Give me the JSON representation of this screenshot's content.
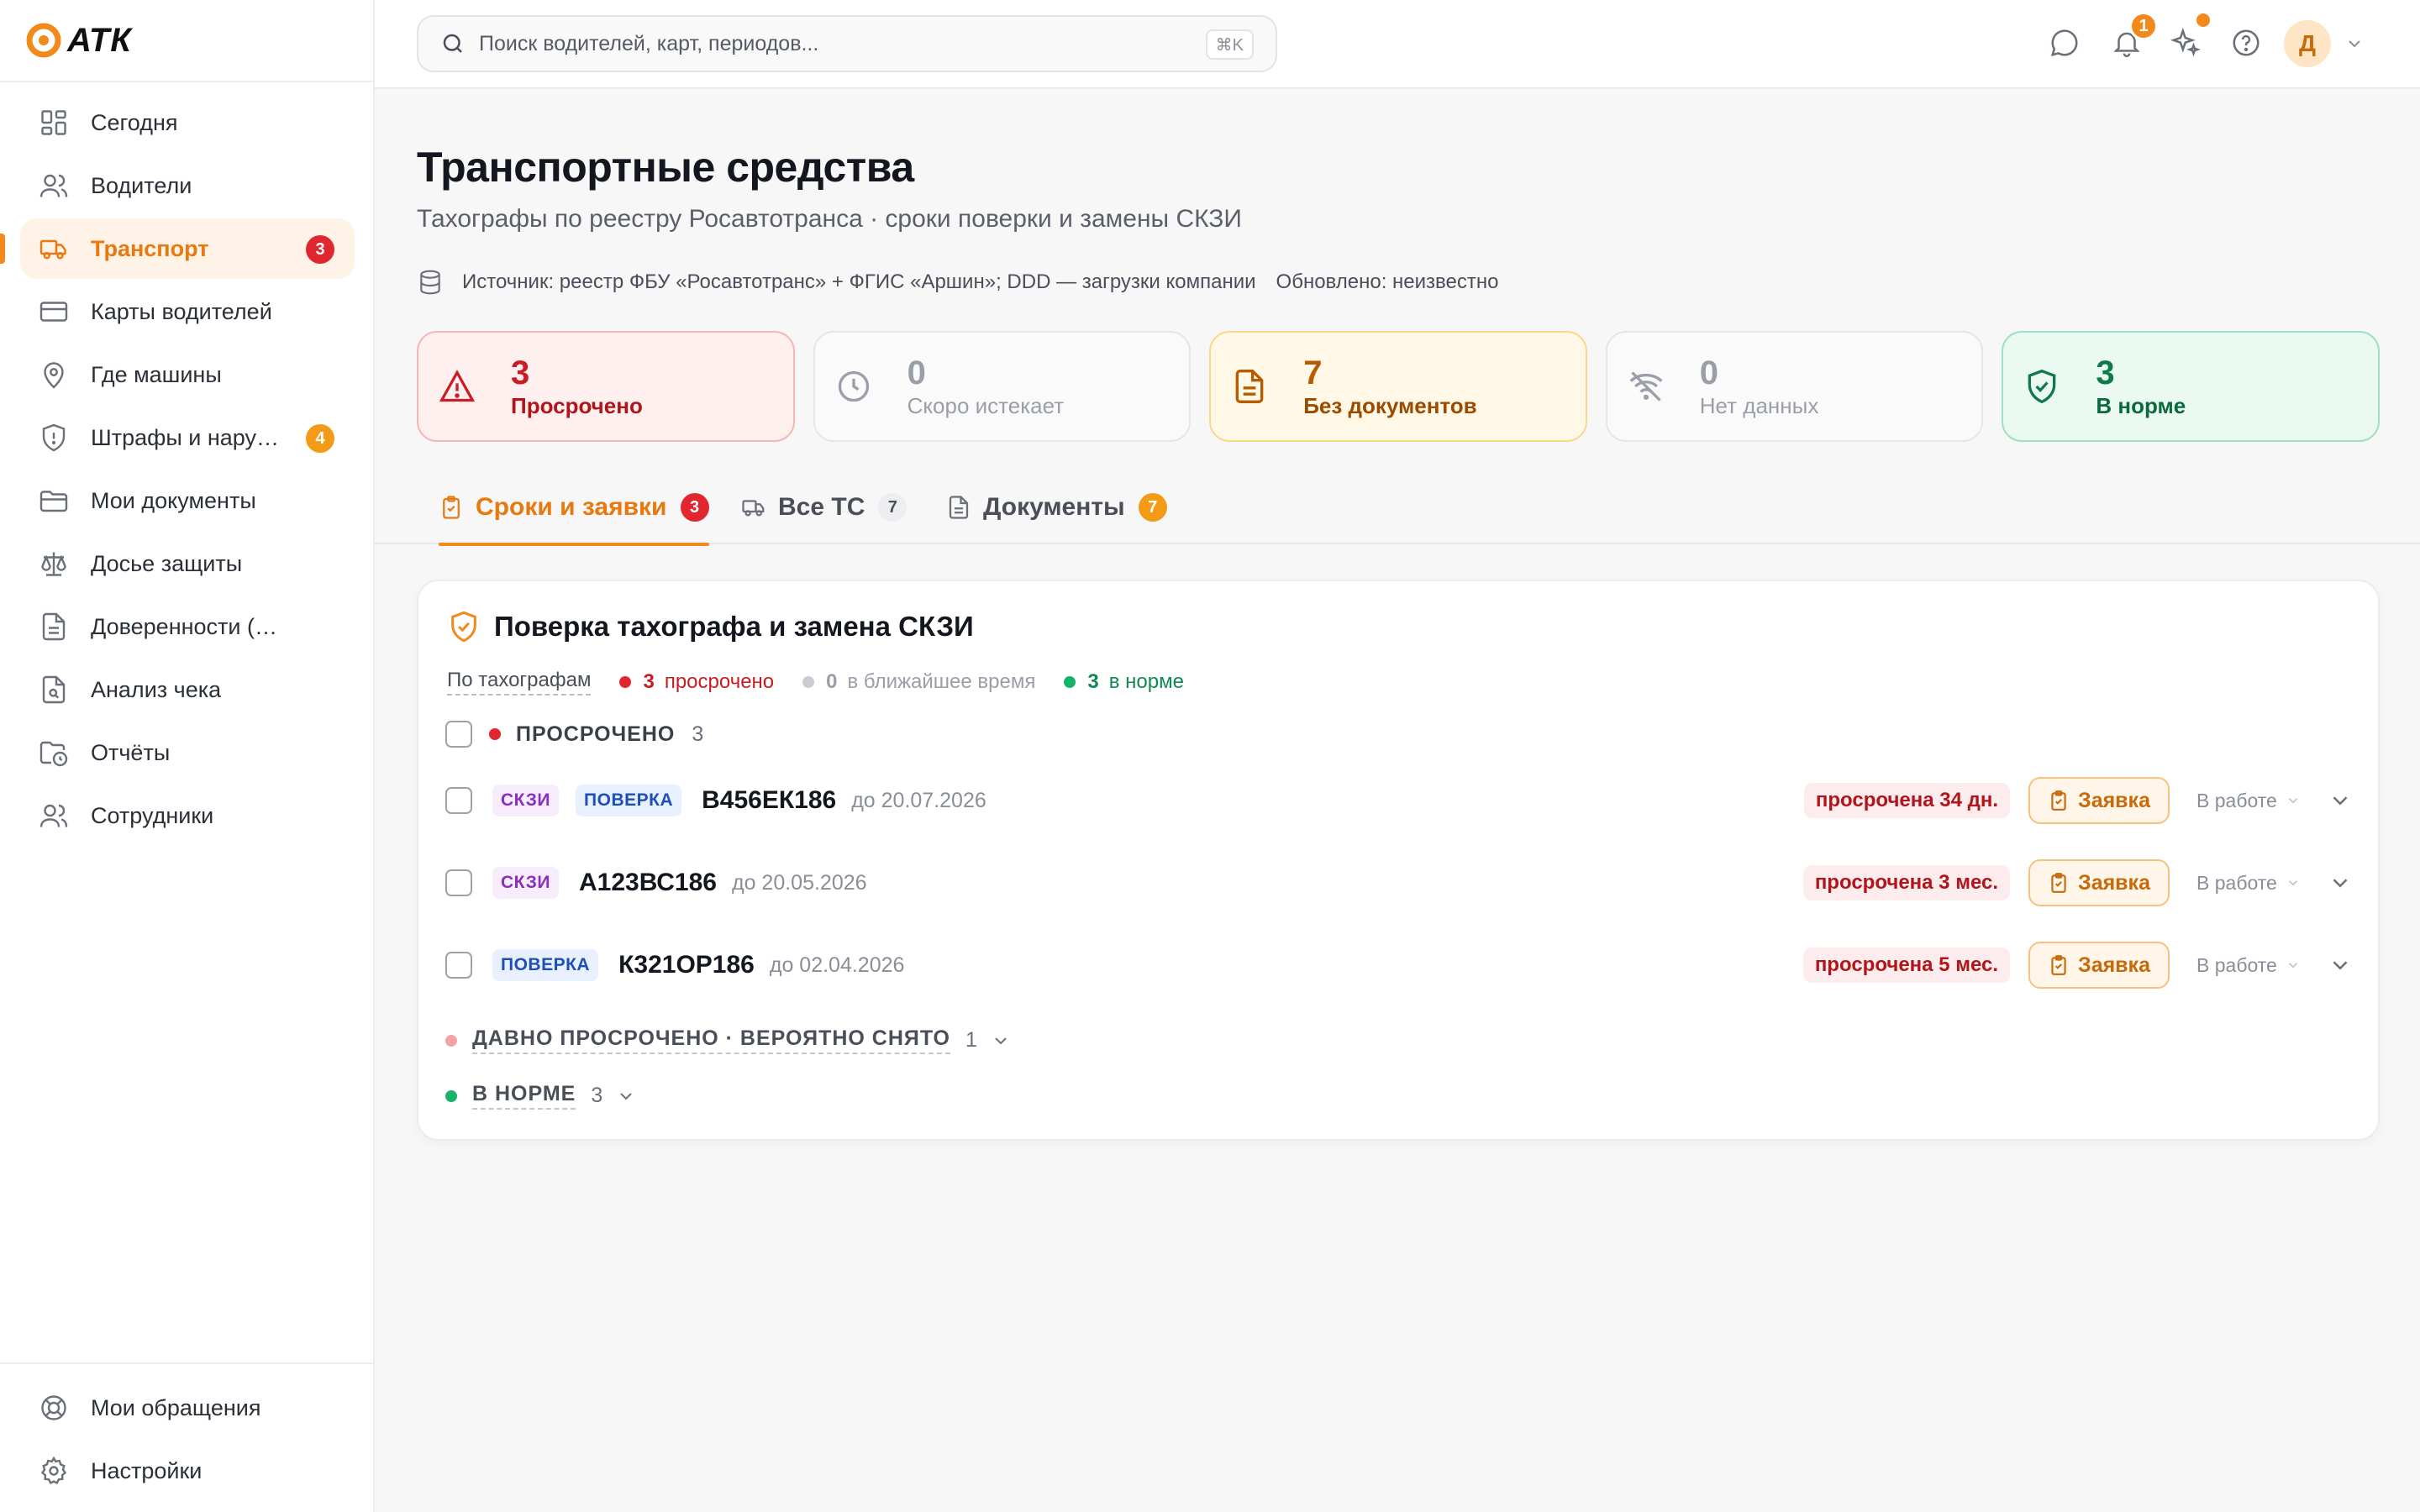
{
  "app": {
    "logo_text": "АТК"
  },
  "sidebar": {
    "items": [
      {
        "label": "Сегодня",
        "icon": "dashboard-grid-icon"
      },
      {
        "label": "Водители",
        "icon": "users-icon"
      },
      {
        "label": "Транспорт",
        "icon": "truck-icon",
        "badge": "3",
        "badge_color": "#e0262e",
        "active": true
      },
      {
        "label": "Карты водителей",
        "icon": "card-icon"
      },
      {
        "label": "Где машины",
        "icon": "map-pin-icon"
      },
      {
        "label": "Штрафы и нару…",
        "icon": "shield-alert-icon",
        "badge": "4",
        "badge_color": "#f39b17"
      },
      {
        "label": "Мои документы",
        "icon": "folder-icon"
      },
      {
        "label": "Досье защиты",
        "icon": "scales-icon"
      },
      {
        "label": "Доверенности (МЧД)",
        "icon": "document-icon"
      },
      {
        "label": "Анализ чека",
        "icon": "receipt-search-icon"
      },
      {
        "label": "Отчёты",
        "icon": "folder-clock-icon"
      },
      {
        "label": "Сотрудники",
        "icon": "users-icon"
      }
    ],
    "bottom": [
      {
        "label": "Мои обращения",
        "icon": "lifebuoy-icon"
      },
      {
        "label": "Настройки",
        "icon": "gear-icon"
      }
    ]
  },
  "topbar": {
    "search_placeholder": "Поиск водителей, карт, периодов...",
    "search_shortcut": "⌘K",
    "notifications_count": "1",
    "avatar_initial": "Д"
  },
  "header": {
    "title": "Транспортные средства",
    "subtitle": "Тахографы по реестру Росавтотранса · сроки поверки и замены СКЗИ",
    "source": "Источник: реестр ФБУ «Росавтотранс» + ФГИС «Аршин»; DDD — загрузки компании",
    "updated": "Обновлено: неизвестно"
  },
  "stats": [
    {
      "value": "3",
      "label": "Просрочено",
      "tone": "red",
      "icon": "warning-triangle-icon"
    },
    {
      "value": "0",
      "label": "Скоро истекает",
      "tone": "gray",
      "icon": "clock-icon"
    },
    {
      "value": "7",
      "label": "Без документов",
      "tone": "amber",
      "icon": "document-icon"
    },
    {
      "value": "0",
      "label": "Нет данных",
      "tone": "gray",
      "icon": "wifi-off-icon"
    },
    {
      "value": "3",
      "label": "В норме",
      "tone": "green",
      "icon": "shield-check-icon"
    }
  ],
  "tabs": [
    {
      "label": "Сроки и заявки",
      "badge": "3",
      "active": true
    },
    {
      "label": "Все ТС",
      "badge": "7"
    },
    {
      "label": "Документы",
      "badge": "7"
    }
  ],
  "card": {
    "title": "Поверка тахографа и замена СКЗИ",
    "filter_by": "По тахографам",
    "filters": [
      {
        "count": "3",
        "label": "просрочено"
      },
      {
        "count": "0",
        "label": "в ближайшее время"
      },
      {
        "count": "3",
        "label": "в норме"
      }
    ],
    "group": {
      "name": "ПРОСРОЧЕНО",
      "count": "3"
    },
    "rows": [
      {
        "tags": [
          "СКЗИ",
          "ПОВЕРКА"
        ],
        "plate": "В456ЕК186",
        "until": "до 20.07.2026",
        "overdue": "просрочена 34 дн.",
        "action": "Заявка",
        "status": "В работе"
      },
      {
        "tags": [
          "СКЗИ"
        ],
        "plate": "А123ВС186",
        "until": "до 20.05.2026",
        "overdue": "просрочена 3 мес.",
        "action": "Заявка",
        "status": "В работе"
      },
      {
        "tags": [
          "ПОВЕРКА"
        ],
        "plate": "К321ОР186",
        "until": "до 02.04.2026",
        "overdue": "просрочена 5 мес.",
        "action": "Заявка",
        "status": "В работе"
      }
    ],
    "collapsed_groups": [
      {
        "name": "ДАВНО ПРОСРОЧЕНО · ВЕРОЯТНО СНЯТО",
        "count": "1",
        "color": "#f2a3a6"
      },
      {
        "name": "В НОРМЕ",
        "count": "3",
        "color": "#16b36b"
      }
    ]
  },
  "colors": {
    "accent": "#f28a1b",
    "danger": "#e0262e",
    "ok": "#16b36b"
  }
}
